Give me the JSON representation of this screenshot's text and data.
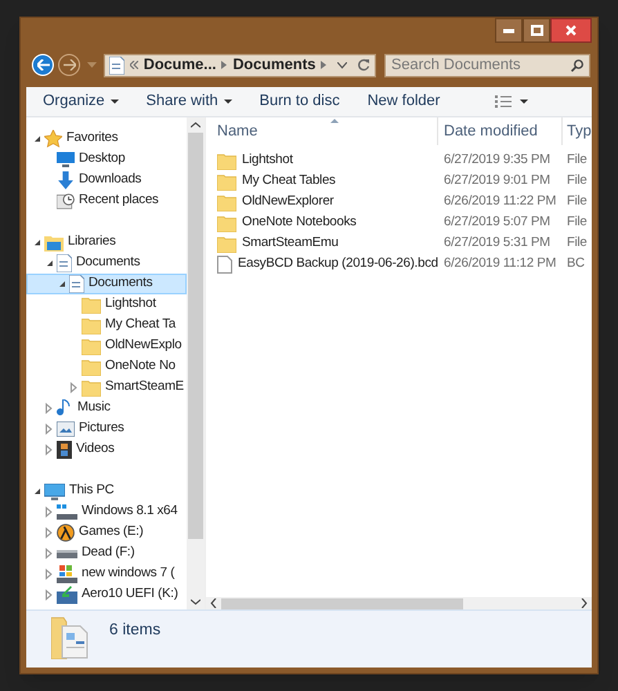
{
  "address": {
    "crumbs": [
      "Docume...",
      "Documents"
    ]
  },
  "search": {
    "placeholder": "Search Documents"
  },
  "toolbar": [
    {
      "label": "Organize",
      "menu": true
    },
    {
      "label": "Share with",
      "menu": true
    },
    {
      "label": "Burn to disc",
      "menu": false
    },
    {
      "label": "New folder",
      "menu": false
    }
  ],
  "sidebar": [
    {
      "label": "Favorites",
      "kind": "star",
      "expanded": true,
      "children": [
        {
          "label": "Desktop",
          "kind": "desktop"
        },
        {
          "label": "Downloads",
          "kind": "download"
        },
        {
          "label": "Recent places",
          "kind": "recent"
        }
      ]
    },
    {
      "label": "Libraries",
      "kind": "library",
      "expanded": true,
      "children": [
        {
          "label": "Documents",
          "kind": "doclib",
          "expanded": true,
          "children": [
            {
              "label": "Documents",
              "kind": "doclib",
              "expanded": true,
              "selected": true,
              "children": [
                {
                  "label": "Lightshot",
                  "kind": "folder"
                },
                {
                  "label": "My Cheat Ta",
                  "kind": "folder"
                },
                {
                  "label": "OldNewExplo",
                  "kind": "folder"
                },
                {
                  "label": "OneNote No",
                  "kind": "folder"
                },
                {
                  "label": "SmartSteamE",
                  "kind": "folder",
                  "expanded": false
                }
              ]
            }
          ]
        },
        {
          "label": "Music",
          "kind": "music",
          "expanded": false
        },
        {
          "label": "Pictures",
          "kind": "pictures",
          "expanded": false
        },
        {
          "label": "Videos",
          "kind": "videos",
          "expanded": false
        }
      ]
    },
    {
      "label": "This PC",
      "kind": "pc",
      "expanded": true,
      "children": [
        {
          "label": "Windows 8.1 x64",
          "kind": "windrive",
          "expanded": false
        },
        {
          "label": "Games (E:)",
          "kind": "games",
          "expanded": false
        },
        {
          "label": "Dead (F:)",
          "kind": "drive",
          "expanded": false
        },
        {
          "label": "new windows 7 (",
          "kind": "win7drive",
          "expanded": false
        },
        {
          "label": "Aero10 UEFI (K:)",
          "kind": "greendrive",
          "expanded": false
        }
      ]
    }
  ],
  "table": {
    "columns": [
      "Name",
      "Date modified",
      "Typ"
    ],
    "rows": [
      {
        "kind": "folder",
        "name": "Lightshot",
        "date": "6/27/2019 9:35 PM",
        "type": "File"
      },
      {
        "kind": "folder",
        "name": "My Cheat Tables",
        "date": "6/27/2019 9:01 PM",
        "type": "File"
      },
      {
        "kind": "folder",
        "name": "OldNewExplorer",
        "date": "6/26/2019 11:22 PM",
        "type": "File"
      },
      {
        "kind": "folder",
        "name": "OneNote Notebooks",
        "date": "6/27/2019 5:07 PM",
        "type": "File"
      },
      {
        "kind": "folder",
        "name": "SmartSteamEmu",
        "date": "6/27/2019 5:31 PM",
        "type": "File"
      },
      {
        "kind": "file",
        "name": "EasyBCD Backup (2019-06-26).bcd",
        "date": "6/26/2019 11:12 PM",
        "type": "BC"
      }
    ]
  },
  "status_bar": {
    "count": "6 items"
  }
}
